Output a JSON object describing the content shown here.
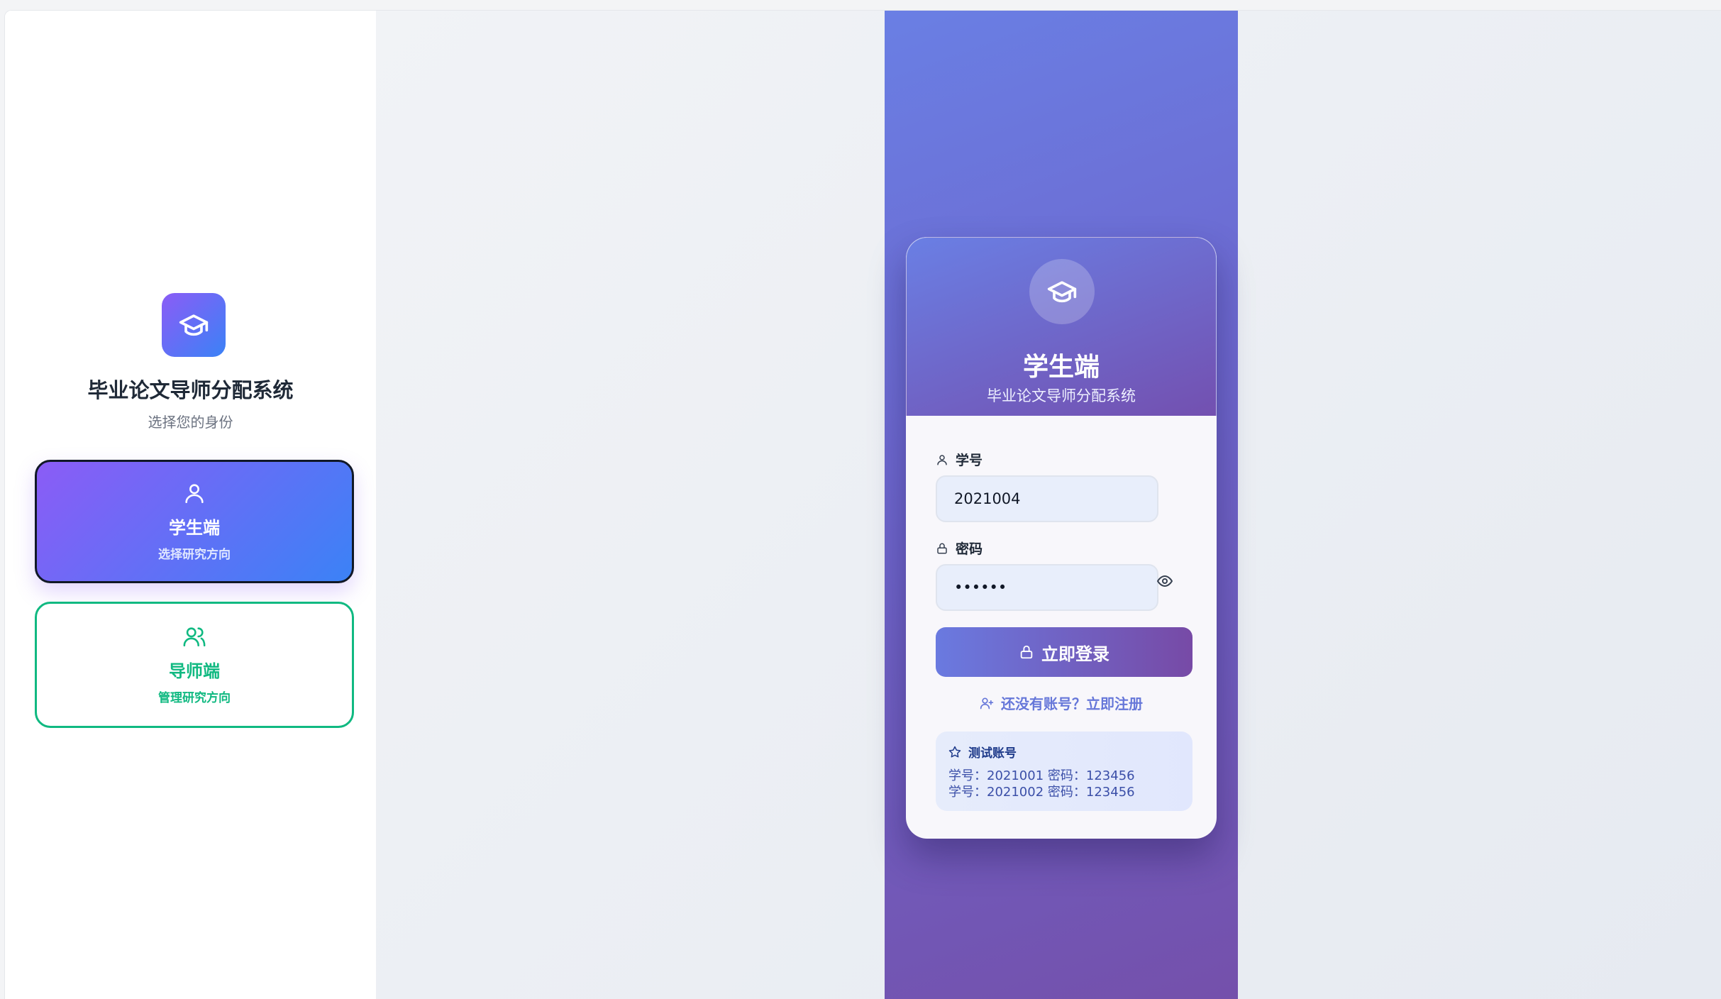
{
  "app": {
    "title": "毕业论文导师分配系统",
    "subtitle": "选择您的身份"
  },
  "roles": [
    {
      "title": "学生端",
      "desc": "选择研究方向",
      "icon": "user-icon",
      "selected": true
    },
    {
      "title": "导师端",
      "desc": "管理研究方向",
      "icon": "users-icon",
      "selected": false
    }
  ],
  "login": {
    "title": "学生端",
    "subtitle": "毕业论文导师分配系统",
    "student_id_label": "学号",
    "student_id_value": "2021004",
    "password_label": "密码",
    "password_value": "••••••",
    "submit_label": "立即登录",
    "register_text": "还没有账号？立即注册",
    "test_accounts": {
      "title": "测试账号",
      "lines": [
        "学号：2021001 密码：123456",
        "学号：2021002 密码：123456"
      ]
    }
  },
  "colors": {
    "student_gradient_start": "#8b5cf6",
    "student_gradient_end": "#3b82f6",
    "teacher_accent": "#10b981",
    "login_purple": "#7350b0",
    "login_blue": "#6a7fe4"
  }
}
